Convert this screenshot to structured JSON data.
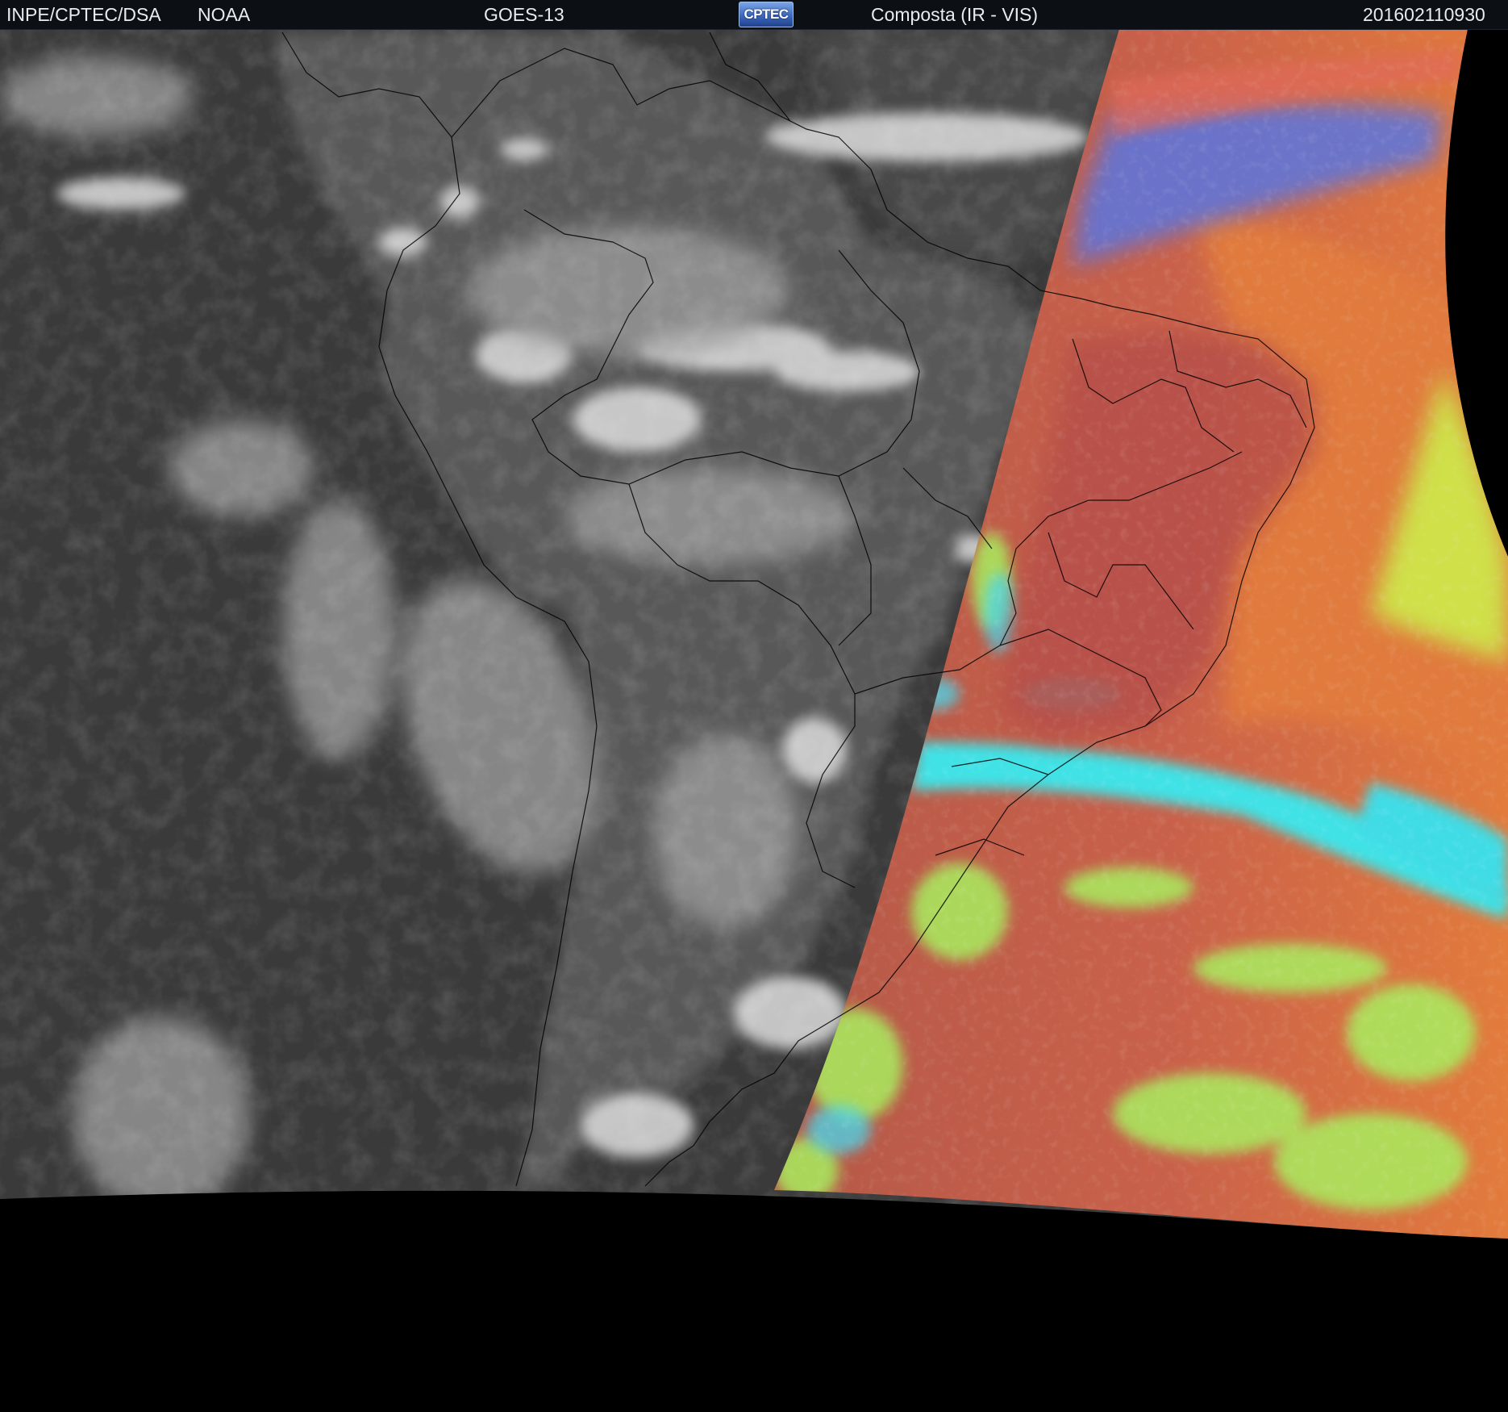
{
  "header": {
    "agency": "INPE/CPTEC/DSA",
    "partner": "NOAA",
    "satellite": "GOES-13",
    "logo_text": "CPTEC",
    "product": "Composta (IR - VIS)",
    "timestamp": "201602110930"
  },
  "colors": {
    "header_bg": "#0c0f14",
    "header_text": "#e8ecf2",
    "ir_ocean": "#3b3b3b",
    "ir_land": "#5a5a5a",
    "ir_cloud": "#d8d8d8",
    "vis_base": "#b85a4a",
    "vis_ocean": "#e0783e",
    "vis_cold_cloud": "#40e0e8",
    "vis_green": "#9cec5a",
    "vis_yellow": "#e8e040",
    "boundaries": "#000000"
  }
}
